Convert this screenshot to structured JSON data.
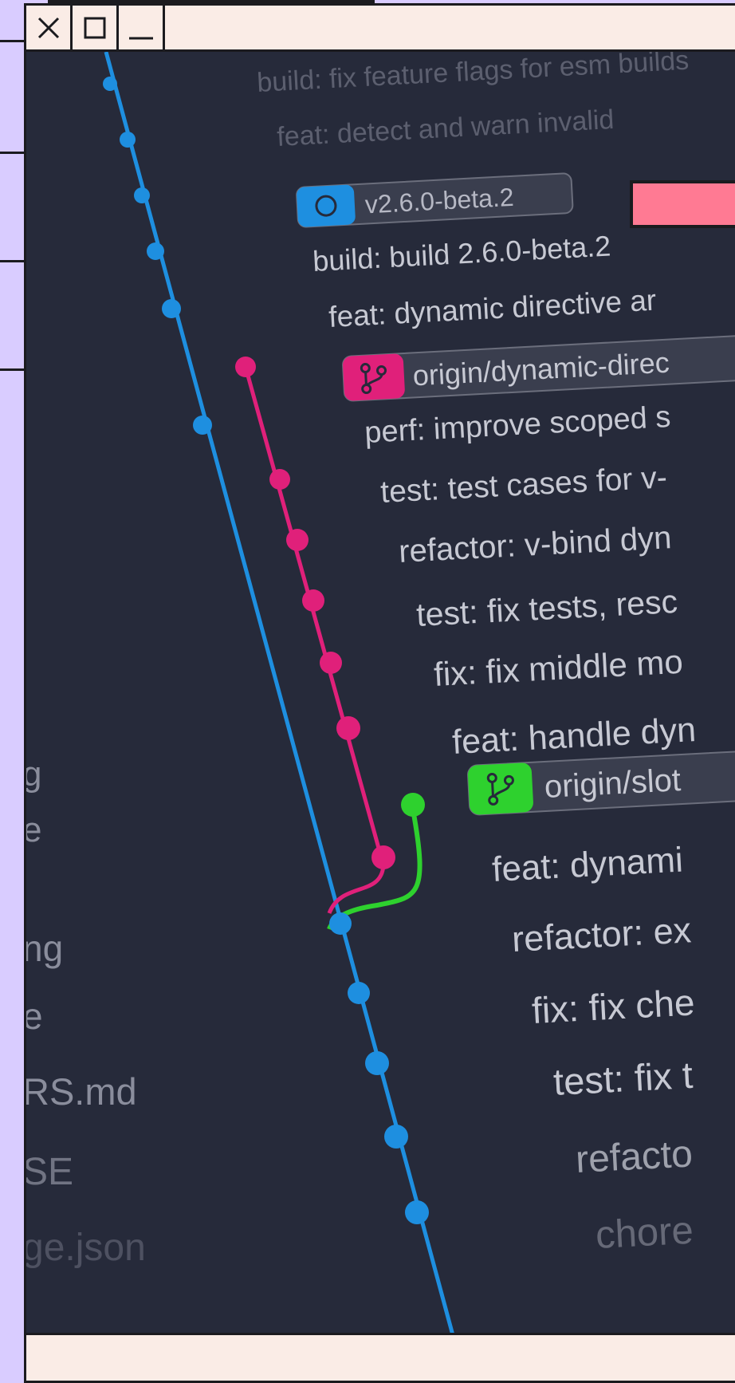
{
  "window": {
    "controls": {
      "close": "close",
      "maximize": "maximize",
      "minimize": "minimize"
    },
    "accent_tab_color": "#ff7a93",
    "background_color": "#faece6"
  },
  "image": {
    "background_color": "#262a3a",
    "colors": {
      "main_branch": "#1e8fe0",
      "branch_pink": "#e0207a",
      "branch_green": "#2ed12e",
      "text": "#c7c9d3"
    },
    "tag": {
      "label": "v2.6.0-beta.2",
      "color": "#1e8fe0"
    },
    "commit_top": [
      "build: fix feature flags for esm builds",
      "feat: detect and warn invalid"
    ],
    "commits_main": [
      "build: build 2.6.0-beta.2",
      "feat: dynamic directive ar",
      "perf: improve scoped s",
      "test: test cases for v-",
      "refactor: v-bind dyn",
      "test: fix tests, resc",
      "fix: fix middle mo",
      "feat: handle dyn",
      "feat: dynami",
      "refactor: ex",
      "fix: fix che",
      "test: fix t",
      "refacto",
      "chore"
    ],
    "branches": [
      {
        "label": "origin/dynamic-direc",
        "color": "#e0207a"
      },
      {
        "label": "origin/slot",
        "color": "#2ed12e"
      }
    ],
    "file_list": [
      "g",
      "e",
      "ng",
      "e",
      "RS.md",
      "SE",
      "ge.json"
    ]
  }
}
